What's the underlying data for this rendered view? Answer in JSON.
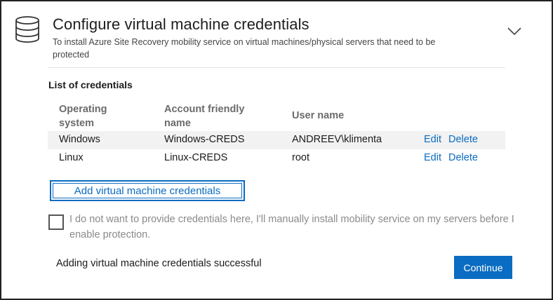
{
  "header": {
    "icon": "database-icon",
    "title": "Configure virtual machine credentials",
    "subtitle": "To install Azure Site Recovery mobility service on virtual machines/physical servers that need to be protected",
    "collapse_icon": "chevron-down-icon"
  },
  "credentials": {
    "list_title": "List of credentials",
    "columns": {
      "os": "Operating system",
      "account": "Account friendly name",
      "user": "User name"
    },
    "rows": [
      {
        "os": "Windows",
        "account": "Windows-CREDS",
        "user": "ANDREEV\\klimenta",
        "edit": "Edit",
        "delete": "Delete"
      },
      {
        "os": "Linux",
        "account": "Linux-CREDS",
        "user": "root",
        "edit": "Edit",
        "delete": "Delete"
      }
    ],
    "add_button": "Add virtual machine credentials"
  },
  "manual_install": {
    "checked": false,
    "label": "I do not want to provide credentials here, I'll manually install mobility service on my servers before I enable protection."
  },
  "footer": {
    "status": "Adding virtual machine credentials successful",
    "continue_button": "Continue"
  },
  "colors": {
    "accent": "#0a6cc2",
    "row_alt": "#f2f2f2",
    "header_text": "#6b6b6b",
    "disabled_text": "#8a8a8a"
  }
}
